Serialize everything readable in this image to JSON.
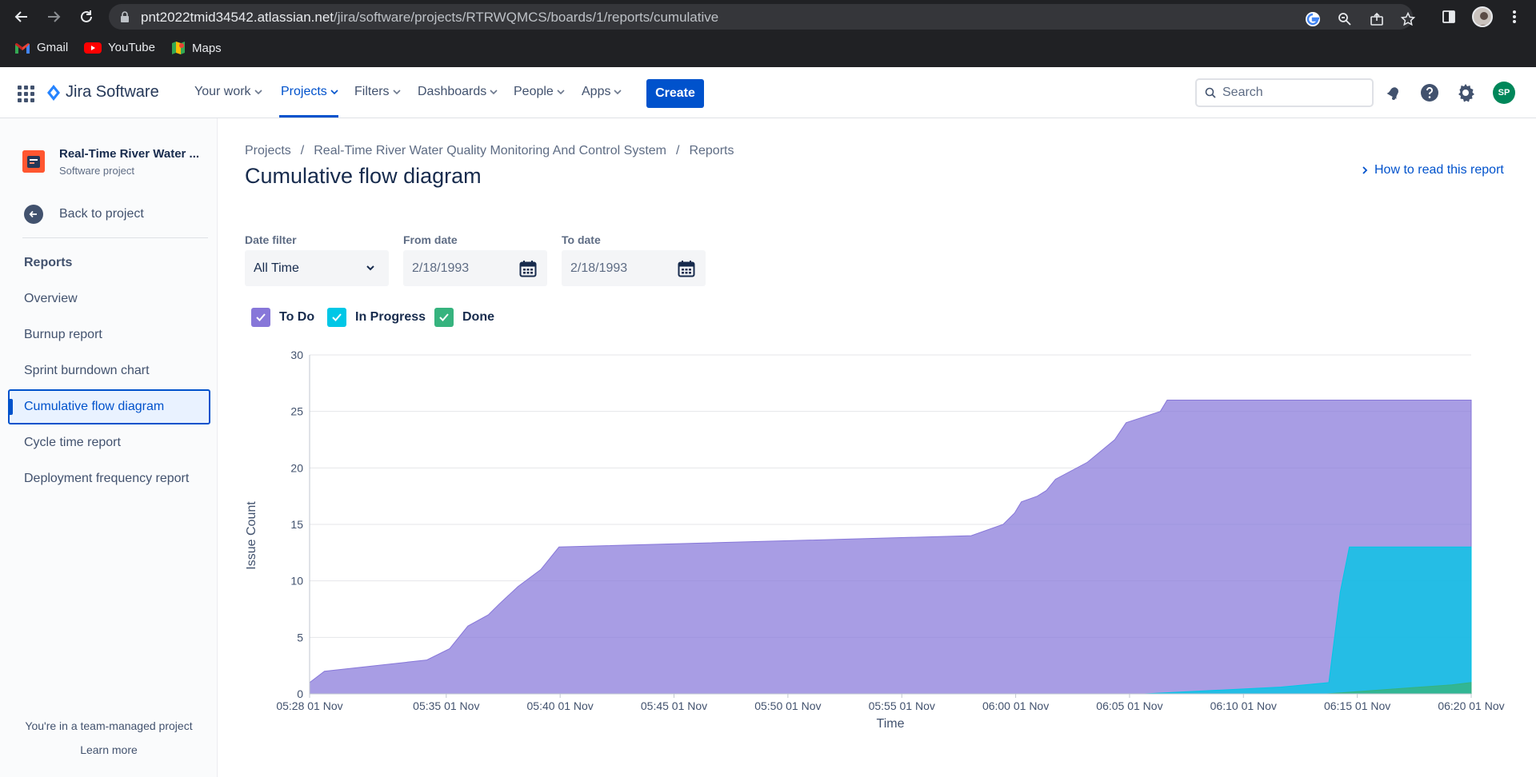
{
  "browser": {
    "url_host": "pnt2022tmid34542.atlassian.net",
    "url_path": "/jira/software/projects/RTRWQMCS/boards/1/reports/cumulative",
    "bookmarks": [
      {
        "label": "Gmail",
        "icon": "gmail-icon"
      },
      {
        "label": "YouTube",
        "icon": "youtube-icon"
      },
      {
        "label": "Maps",
        "icon": "maps-icon"
      }
    ]
  },
  "topnav": {
    "product": "Jira Software",
    "items": [
      "Your work",
      "Projects",
      "Filters",
      "Dashboards",
      "People",
      "Apps"
    ],
    "active": "Projects",
    "create_label": "Create",
    "search_placeholder": "Search",
    "avatar_initials": "SP",
    "accent_color": "#0052cc"
  },
  "sidebar": {
    "project_name": "Real-Time River Water ...",
    "project_type": "Software project",
    "back_label": "Back to project",
    "section_heading": "Reports",
    "items": [
      "Overview",
      "Burnup report",
      "Sprint burndown chart",
      "Cumulative flow diagram",
      "Cycle time report",
      "Deployment frequency report"
    ],
    "selected": "Cumulative flow diagram",
    "footer_text": "You're in a team-managed project",
    "footer_link": "Learn more"
  },
  "main": {
    "breadcrumb": [
      "Projects",
      "Real-Time River Water Quality Monitoring And Control System",
      "Reports"
    ],
    "title": "Cumulative flow diagram",
    "help_link": "How to read this report",
    "filters": {
      "date_filter_label": "Date filter",
      "date_filter_value": "All Time",
      "from_label": "From date",
      "from_value": "2/18/1993",
      "to_label": "To date",
      "to_value": "2/18/1993"
    },
    "legend": [
      {
        "label": "To Do",
        "color": "#8777d9",
        "checked": true
      },
      {
        "label": "In Progress",
        "color": "#00c7e6",
        "checked": true
      },
      {
        "label": "Done",
        "color": "#36b37e",
        "checked": true
      }
    ]
  },
  "chart_data": {
    "type": "area",
    "xlabel": "Time",
    "ylabel": "Issue Count",
    "ylim": [
      0,
      30
    ],
    "yticks": [
      0,
      5,
      10,
      15,
      20,
      25,
      30
    ],
    "x_ticks": [
      "05:28 01 Nov",
      "05:35 01 Nov",
      "05:40 01 Nov",
      "05:45 01 Nov",
      "05:50 01 Nov",
      "05:55 01 Nov",
      "06:00 01 Nov",
      "06:05 01 Nov",
      "06:10 01 Nov",
      "06:15 01 Nov",
      "06:20 01 Nov"
    ],
    "x_tick_minutes": [
      -0.65,
      5.35,
      10.35,
      15.35,
      20.35,
      25.35,
      30.35,
      35.35,
      40.35,
      45.35,
      50.35
    ],
    "x_range_minutes": [
      -0.65,
      50.35
    ],
    "grid": true,
    "x_unit": "minutes after 05:29 01 Nov",
    "series": [
      {
        "name": "Done",
        "color": "#36b37e",
        "points": [
          [
            -0.65,
            0
          ],
          [
            44,
            0
          ],
          [
            49.5,
            0.8
          ],
          [
            50.35,
            1
          ],
          [
            50.35,
            0
          ]
        ]
      },
      {
        "name": "In Progress",
        "color": "#00c7e6",
        "points": [
          [
            -0.65,
            0
          ],
          [
            36,
            0
          ],
          [
            42,
            0.6
          ],
          [
            44.1,
            1
          ],
          [
            44.6,
            9
          ],
          [
            45,
            13
          ],
          [
            50.35,
            13
          ]
        ]
      },
      {
        "name": "To Do",
        "color": "#8777d9",
        "points": [
          [
            -0.65,
            1
          ],
          [
            0,
            2
          ],
          [
            4.5,
            3
          ],
          [
            5.5,
            4
          ],
          [
            6.3,
            6
          ],
          [
            7.2,
            7
          ],
          [
            7.7,
            8
          ],
          [
            8.5,
            9.5
          ],
          [
            9.5,
            11
          ],
          [
            10.3,
            13
          ],
          [
            28.4,
            14
          ],
          [
            29.8,
            15
          ],
          [
            30.3,
            16
          ],
          [
            30.6,
            17
          ],
          [
            31.3,
            17.5
          ],
          [
            31.7,
            18
          ],
          [
            32.1,
            19
          ],
          [
            33.5,
            20.5
          ],
          [
            34.1,
            21.5
          ],
          [
            34.7,
            22.5
          ],
          [
            35.2,
            24
          ],
          [
            36.7,
            25
          ],
          [
            37,
            26
          ],
          [
            50.35,
            26
          ]
        ]
      }
    ]
  }
}
